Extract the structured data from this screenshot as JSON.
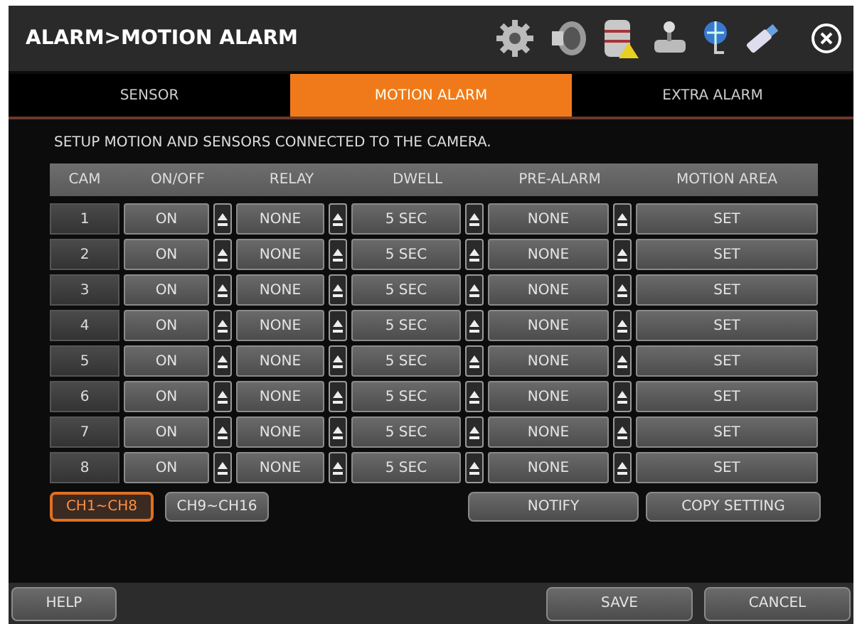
{
  "window": {
    "title": "ALARM>MOTION ALARM"
  },
  "tabs": [
    {
      "label": "SENSOR",
      "selected": false
    },
    {
      "label": "MOTION ALARM",
      "selected": true
    },
    {
      "label": "EXTRA ALARM",
      "selected": false
    }
  ],
  "description": "SETUP MOTION AND SENSORS CONNECTED TO THE CAMERA.",
  "table": {
    "columns": [
      "CAM",
      "ON/OFF",
      "RELAY",
      "DWELL",
      "PRE-ALARM",
      "MOTION AREA"
    ],
    "rows": [
      {
        "cam": "1",
        "on_off": "ON",
        "relay": "NONE",
        "dwell": "5 SEC",
        "pre_alarm": "NONE",
        "motion_area": "SET"
      },
      {
        "cam": "2",
        "on_off": "ON",
        "relay": "NONE",
        "dwell": "5 SEC",
        "pre_alarm": "NONE",
        "motion_area": "SET"
      },
      {
        "cam": "3",
        "on_off": "ON",
        "relay": "NONE",
        "dwell": "5 SEC",
        "pre_alarm": "NONE",
        "motion_area": "SET"
      },
      {
        "cam": "4",
        "on_off": "ON",
        "relay": "NONE",
        "dwell": "5 SEC",
        "pre_alarm": "NONE",
        "motion_area": "SET"
      },
      {
        "cam": "5",
        "on_off": "ON",
        "relay": "NONE",
        "dwell": "5 SEC",
        "pre_alarm": "NONE",
        "motion_area": "SET"
      },
      {
        "cam": "6",
        "on_off": "ON",
        "relay": "NONE",
        "dwell": "5 SEC",
        "pre_alarm": "NONE",
        "motion_area": "SET"
      },
      {
        "cam": "7",
        "on_off": "ON",
        "relay": "NONE",
        "dwell": "5 SEC",
        "pre_alarm": "NONE",
        "motion_area": "SET"
      },
      {
        "cam": "8",
        "on_off": "ON",
        "relay": "NONE",
        "dwell": "5 SEC",
        "pre_alarm": "NONE",
        "motion_area": "SET"
      }
    ]
  },
  "channel_groups": [
    {
      "label": "CH1~CH8",
      "selected": true
    },
    {
      "label": "CH9~CH16",
      "selected": false
    }
  ],
  "actions": [
    "NOTIFY",
    "COPY SETTING"
  ],
  "footer": {
    "help": "HELP",
    "save": "SAVE",
    "cancel": "CANCEL"
  }
}
